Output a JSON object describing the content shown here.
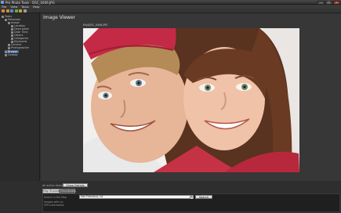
{
  "window": {
    "title": "Pro Photo Tools - DSC_0406.JPG"
  },
  "menu": [
    "File",
    "View",
    "Tools",
    "Help"
  ],
  "toolbar": {
    "buttons": [
      {
        "icon": "back-icon",
        "color": "#d88a2e"
      },
      {
        "icon": "forward-icon",
        "color": "#d88a2e"
      },
      {
        "icon": "refresh-icon",
        "color": "#4f8fcf"
      },
      {
        "icon": "geotag-icon",
        "color": "#6aa84f"
      },
      {
        "icon": "map-icon",
        "color": "#c9a227"
      },
      {
        "icon": "settings-icon",
        "color": "#9e9e9e"
      }
    ]
  },
  "tree": [
    {
      "label": "Tasks",
      "depth": 0
    },
    {
      "label": "Metadata",
      "depth": 1
    },
    {
      "label": "Image",
      "depth": 2
    },
    {
      "label": "Location",
      "depth": 3
    },
    {
      "label": "Description",
      "depth": 3
    },
    {
      "label": "Date Time",
      "depth": 3
    },
    {
      "label": "Others",
      "depth": 3
    },
    {
      "label": "Categories",
      "depth": 3
    },
    {
      "label": "Keywords",
      "depth": 3
    },
    {
      "label": "Camera",
      "depth": 2
    },
    {
      "label": "Photographer",
      "depth": 2
    },
    {
      "label": "Browse",
      "depth": 1,
      "selected": true
    },
    {
      "label": "Geotag",
      "depth": 1
    }
  ],
  "viewer": {
    "title": "Image Viewer",
    "filename": "Elsi\\DSC_0406.JPG"
  },
  "bottom": {
    "crumb": "All active directory",
    "show_details": "Show Details",
    "tabs": [
      "Map Browser",
      "Thumbnails"
    ],
    "search_label": "Search in the Map",
    "search_value": "San Francisco, CA",
    "search_button": "Search",
    "images_label": "Images with no GPS information"
  },
  "colors": {
    "selection": "#3d5f8f",
    "background": "#373737"
  }
}
